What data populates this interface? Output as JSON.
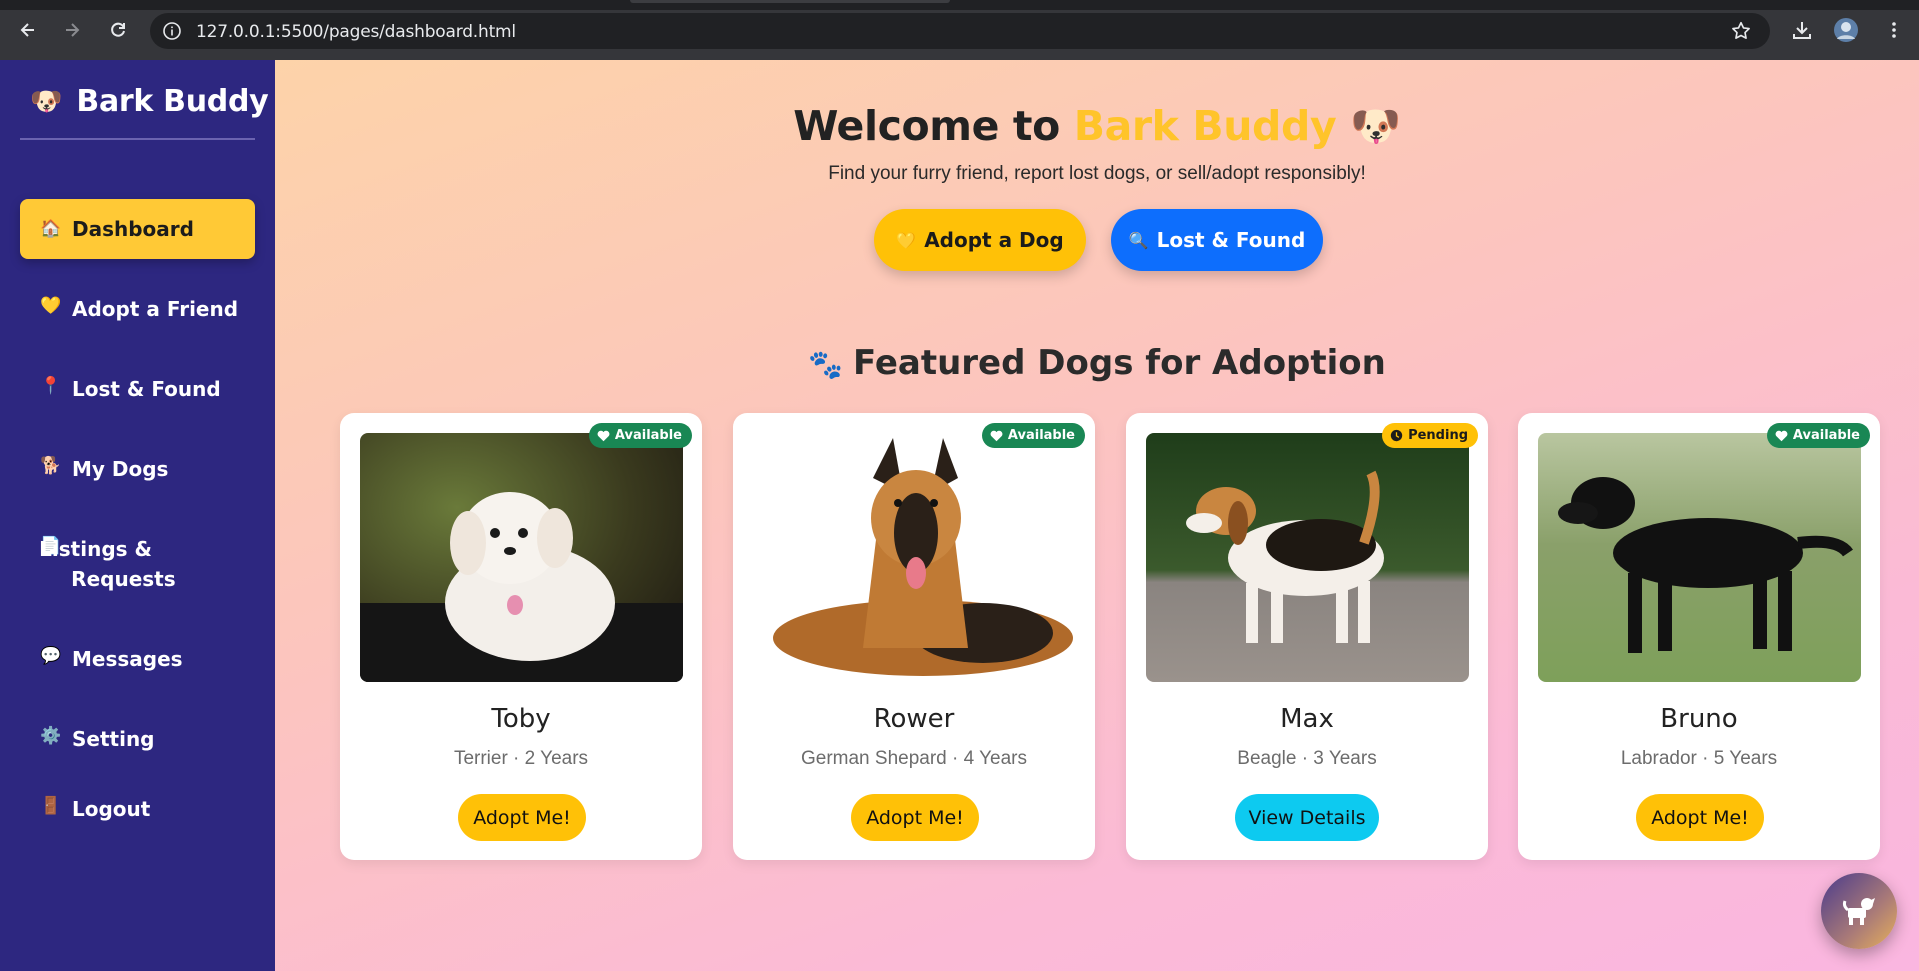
{
  "browser": {
    "url": "127.0.0.1:5500/pages/dashboard.html"
  },
  "sidebar": {
    "brand_emoji": "🐶",
    "brand_name": "Bark Buddy",
    "items": [
      {
        "icon": "🏠",
        "label": "Dashboard",
        "active": true
      },
      {
        "icon": "💛",
        "label": "Adopt a Friend"
      },
      {
        "icon": "📍",
        "label": "Lost & Found"
      },
      {
        "icon": "🐕",
        "label": "My Dogs"
      },
      {
        "icon": "📄",
        "label": "Listings & Requests"
      },
      {
        "icon": "💬",
        "label": "Messages"
      },
      {
        "icon": "⚙️",
        "label": "Setting"
      },
      {
        "icon": "🚪",
        "label": "Logout"
      }
    ]
  },
  "hero": {
    "title_prefix": "Welcome to ",
    "title_accent": "Bark Buddy",
    "title_emoji": "🐶",
    "subtitle": "Find your furry friend, report lost dogs, or sell/adopt responsibly!",
    "adopt_icon": "💛",
    "adopt_label": "Adopt a Dog",
    "lost_icon": "🔍",
    "lost_label": "Lost & Found"
  },
  "featured": {
    "paw_icon": "🐾",
    "title": "Featured Dogs for Adoption",
    "dogs": [
      {
        "name": "Toby",
        "meta": "Terrier · 2 Years",
        "status": "Available",
        "button": "Adopt Me!"
      },
      {
        "name": "Rower",
        "meta": "German Shepard · 4 Years",
        "status": "Available",
        "button": "Adopt Me!"
      },
      {
        "name": "Max",
        "meta": "Beagle · 3 Years",
        "status": "Pending",
        "button": "View Details"
      },
      {
        "name": "Bruno",
        "meta": "Labrador · 5 Years",
        "status": "Available",
        "button": "Adopt Me!"
      }
    ]
  },
  "colors": {
    "sidebar": "#2d2780",
    "accent_yellow": "#ffc107",
    "primary_blue": "#0d6efd",
    "info_cyan": "#0dcaf0",
    "success_green": "#198754"
  },
  "icons": {
    "back": "arrow-left-icon",
    "forward": "arrow-right-icon",
    "reload": "reload-icon",
    "site_info": "site-info-icon",
    "bookmark": "star-icon",
    "download": "download-icon",
    "profile": "avatar",
    "menu": "kebab-menu-icon",
    "fab": "dog-icon"
  }
}
